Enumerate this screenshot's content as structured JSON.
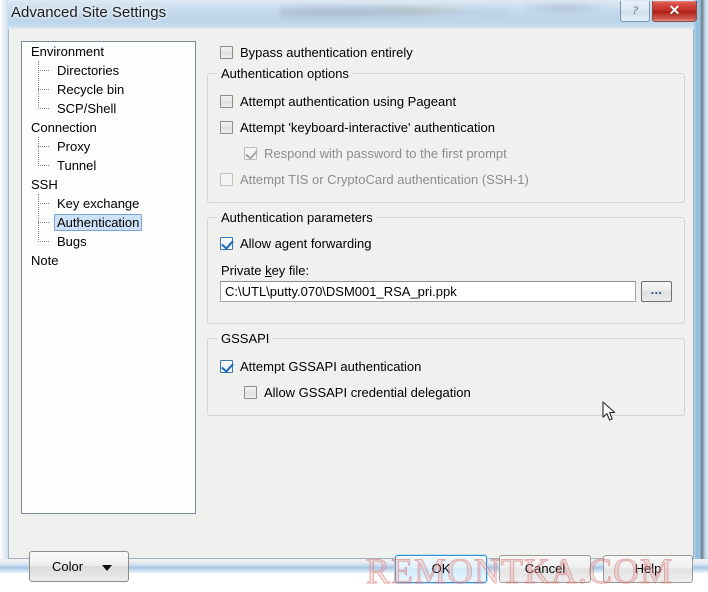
{
  "window": {
    "title": "Advanced Site Settings",
    "help_button_glyph": "?",
    "close_button_glyph": "✕"
  },
  "sidebar": {
    "items": [
      {
        "label": "Environment",
        "level": 0,
        "selected": false
      },
      {
        "label": "Directories",
        "level": 1,
        "selected": false
      },
      {
        "label": "Recycle bin",
        "level": 1,
        "selected": false
      },
      {
        "label": "SCP/Shell",
        "level": 1,
        "selected": false
      },
      {
        "label": "Connection",
        "level": 0,
        "selected": false
      },
      {
        "label": "Proxy",
        "level": 1,
        "selected": false
      },
      {
        "label": "Tunnel",
        "level": 1,
        "selected": false
      },
      {
        "label": "SSH",
        "level": 0,
        "selected": false
      },
      {
        "label": "Key exchange",
        "level": 1,
        "selected": false
      },
      {
        "label": "Authentication",
        "level": 1,
        "selected": true
      },
      {
        "label": "Bugs",
        "level": 1,
        "selected": false
      },
      {
        "label": "Note",
        "level": 0,
        "selected": false
      }
    ]
  },
  "main": {
    "bypass": {
      "label": "Bypass authentication entirely",
      "checked": false,
      "disabled": false
    },
    "auth_options": {
      "title": "Authentication options",
      "checkboxes": [
        {
          "label": "Attempt authentication using Pageant",
          "checked": false,
          "disabled": false,
          "indent": 0
        },
        {
          "label": "Attempt 'keyboard-interactive' authentication",
          "checked": false,
          "disabled": false,
          "indent": 0
        },
        {
          "label": "Respond with password to the first prompt",
          "checked": true,
          "disabled": true,
          "indent": 1
        },
        {
          "label": "Attempt TIS or CryptoCard authentication (SSH-1)",
          "checked": false,
          "disabled": true,
          "indent": 0
        }
      ]
    },
    "auth_parameters": {
      "title": "Authentication parameters",
      "agent_forwarding": {
        "label": "Allow agent forwarding",
        "checked": true,
        "disabled": false
      },
      "private_key_label_pre": "Private ",
      "private_key_label_accel": "k",
      "private_key_label_post": "ey file:",
      "private_key_value": "C:\\UTL\\putty.070\\DSM001_RSA_pri.ppk",
      "browse_label": "..."
    },
    "gssapi": {
      "title": "GSSAPI",
      "checkboxes": [
        {
          "label": "Attempt GSSAPI authentication",
          "checked": true,
          "disabled": false,
          "indent": 0
        },
        {
          "label": "Allow GSSAPI credential delegation",
          "checked": false,
          "disabled": false,
          "indent": 1
        }
      ]
    }
  },
  "footer": {
    "color_label": "Color",
    "ok_label": "OK",
    "cancel_label": "Cancel",
    "help_label": "Help"
  },
  "watermark": {
    "text": "REMONTKA.COM"
  },
  "colors": {
    "accent": "#2e8fd6",
    "selection": "#cde2f7",
    "checkmark": "#1b67b5",
    "close_red": "#c22f26",
    "watermark": "#d67878",
    "disabled_text": "#8d8d8d"
  }
}
